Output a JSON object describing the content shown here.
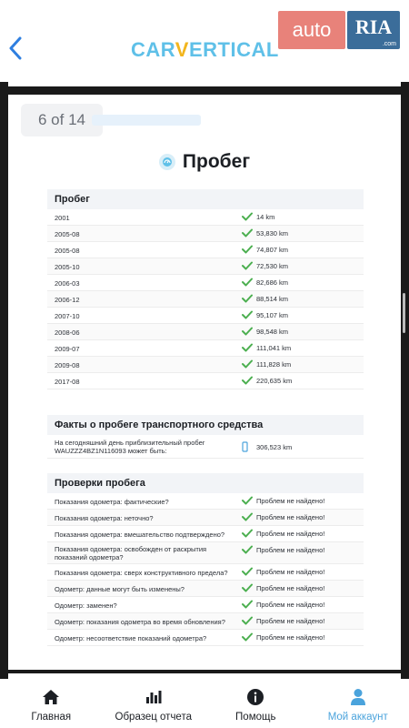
{
  "header": {
    "logo_pre": "CAR",
    "logo_v": "V",
    "logo_post": "ERTICAL",
    "badge_left": "auto",
    "badge_right": "RIA",
    "badge_com": ".com"
  },
  "pager": {
    "label": "6 of 14"
  },
  "section": {
    "title": "Пробег"
  },
  "mileage": {
    "heading": "Пробег",
    "rows": [
      {
        "date": "2001",
        "value": "14 km"
      },
      {
        "date": "2005-08",
        "value": "53,830 km"
      },
      {
        "date": "2005-08",
        "value": "74,807 km"
      },
      {
        "date": "2005-10",
        "value": "72,530 km"
      },
      {
        "date": "2006-03",
        "value": "82,686 km"
      },
      {
        "date": "2006-12",
        "value": "88,514 km"
      },
      {
        "date": "2007-10",
        "value": "95,107 km"
      },
      {
        "date": "2008-06",
        "value": "98,548 km"
      },
      {
        "date": "2009-07",
        "value": "111,041 km"
      },
      {
        "date": "2009-08",
        "value": "111,828 km"
      },
      {
        "date": "2017-08",
        "value": "220,635 km"
      }
    ]
  },
  "facts": {
    "heading": "Факты о пробеге транспортного средства",
    "line1": "На сегодняшний день приблизительный пробег",
    "line2": "WAUZZZ4BZ1N116093 может быть:",
    "value": "306,523 km"
  },
  "checks": {
    "heading": "Проверки пробега",
    "rows": [
      {
        "label": "Показания одометра: фактические?",
        "result": "Проблем не найдено!"
      },
      {
        "label": "Показания одометра: неточно?",
        "result": "Проблем не найдено!"
      },
      {
        "label": "Показания одометра: вмешательство подтверждено?",
        "result": "Проблем не найдено!"
      },
      {
        "label": "Показания одометра: освобожден от раскрытия показаний одометра?",
        "result": "Проблем не найдено!"
      },
      {
        "label": "Показания одометра: сверх конструктивного предела?",
        "result": "Проблем не найдено!"
      },
      {
        "label": "Одометр: данные могут быть изменены?",
        "result": "Проблем не найдено!"
      },
      {
        "label": "Одометр: заменен?",
        "result": "Проблем не найдено!"
      },
      {
        "label": "Одометр: показания одометра во время обновления?",
        "result": "Проблем не найдено!"
      },
      {
        "label": "Одометр: несоответствие показаний одометра?",
        "result": "Проблем не найдено!"
      }
    ]
  },
  "nav": {
    "items": [
      {
        "label": "Главная",
        "icon": "home-icon"
      },
      {
        "label": "Образец отчета",
        "icon": "bar-chart-icon"
      },
      {
        "label": "Помощь",
        "icon": "info-icon"
      },
      {
        "label": "Мой аккаунт",
        "icon": "user-icon"
      }
    ],
    "active": "Мой аккаунт"
  },
  "colors": {
    "accent": "#4aa3dc",
    "check": "#4caf50",
    "logo": "#5fc0e8",
    "badge_left": "#e8827a",
    "badge_right": "#3b6d9a"
  }
}
